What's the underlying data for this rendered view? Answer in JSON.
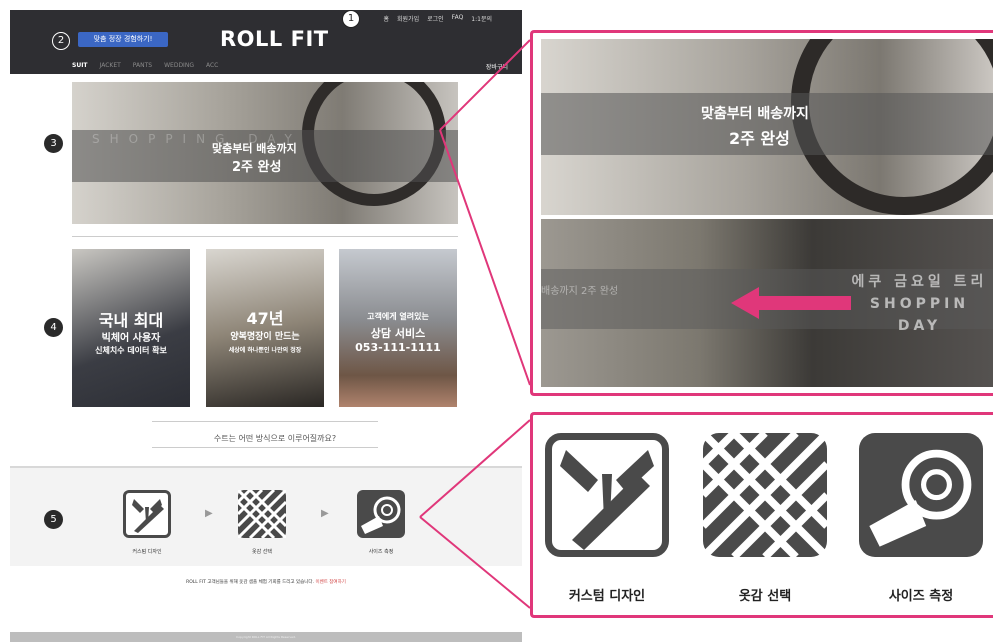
{
  "header": {
    "top_links": [
      "홈",
      "회원가입",
      "로그인",
      "FAQ",
      "1:1문의"
    ],
    "logo": "ROLL FIT",
    "cta_label": "맞춤 정장 경험하기!",
    "nav": [
      "SUIT",
      "JACKET",
      "PANTS",
      "WEDDING",
      "ACC"
    ],
    "cart_label": "장바구니"
  },
  "markers": [
    "1",
    "2",
    "3",
    "4",
    "5"
  ],
  "hero": {
    "line1": "맞춤부터 배송까지",
    "line2": "2주 완성",
    "ghost": "SHOPPING DAY"
  },
  "cards": [
    {
      "line1": "국내 최대",
      "line2": "빅체어 사용자",
      "line3": "신체치수 데이터 확보"
    },
    {
      "line1": "47년",
      "line2": "양복명장이 만드는",
      "line3": "세상에 하나뿐인 나만의 정장"
    },
    {
      "line1": "고객에게 열려있는",
      "line2": "상담 서비스",
      "line3": "053-111-1111"
    }
  ],
  "question": "수트는 어떤 방식으로 이루어질까요?",
  "steps": [
    {
      "label": "커스텀 디자인",
      "icon": "suit-tie-pen-icon"
    },
    {
      "label": "옷감 선택",
      "icon": "fabric-weave-icon"
    },
    {
      "label": "사이즈 측정",
      "icon": "tape-measure-icon"
    }
  ],
  "notice": {
    "main": "ROLL FIT 고객님들을 위해 옷감 샘플 체험 기회를 드리고 있습니다.",
    "highlight": "이벤트 참여하기"
  },
  "footer": "Copyright ROLL FIT All Rights Reserved.",
  "zoom_panel": {
    "line1": "맞춤부터 배송까지",
    "line2": "2주 완성",
    "ghost_left": "배송까지 2주 완성",
    "ghost_right": "에쿠 금요일 트리 SHOPPIN DAY"
  },
  "colors": {
    "header_bg": "#2e2e32",
    "cta_blue": "#3b67c4",
    "highlight_pink": "#e0377a",
    "icon_gray": "#4a4a4a"
  }
}
